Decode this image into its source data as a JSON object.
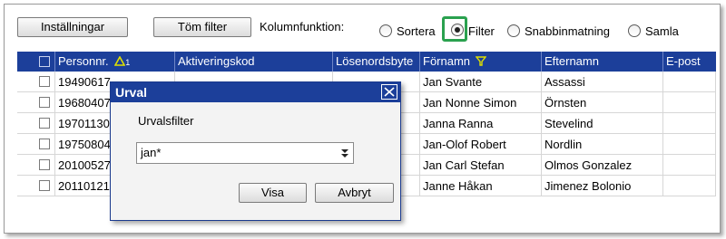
{
  "toolbar": {
    "settings_label": "Inställningar",
    "clear_filter_label": "Töm filter",
    "column_function_label": "Kolumnfunktion:",
    "options": [
      {
        "label": "Sortera",
        "selected": false
      },
      {
        "label": "Filter",
        "selected": true
      },
      {
        "label": "Snabbinmatning",
        "selected": false
      },
      {
        "label": "Samla",
        "selected": false
      }
    ]
  },
  "grid": {
    "columns": [
      "Personnr.",
      "Aktiveringskod",
      "Lösenordsbyte",
      "Förnamn",
      "Efternamn",
      "E-post"
    ],
    "sort_indicator": "1",
    "rows": [
      {
        "personnr": "19490617",
        "fornamn": "Jan Svante",
        "efternamn": "Assassi"
      },
      {
        "personnr": "19680407",
        "fornamn": "Jan Nonne Simon",
        "efternamn": "Örnsten"
      },
      {
        "personnr": "19701130",
        "fornamn": "Janna Ranna",
        "efternamn": "Stevelind"
      },
      {
        "personnr": "19750804",
        "fornamn": "Jan-Olof Robert",
        "efternamn": "Nordlin"
      },
      {
        "personnr": "20100527",
        "fornamn": "Jan Carl Stefan",
        "efternamn": "Olmos Gonzalez"
      },
      {
        "personnr": "20110121",
        "fornamn": "Janne Håkan",
        "efternamn": "Jimenez Bolonio"
      }
    ]
  },
  "dialog": {
    "title": "Urval",
    "filter_label": "Urvalsfilter",
    "filter_value": "jan*",
    "ok_label": "Visa",
    "cancel_label": "Avbryt"
  },
  "colors": {
    "header_bg": "#1c3f9a",
    "highlight": "#2aa14f",
    "filter_icon": "#e0e000"
  }
}
